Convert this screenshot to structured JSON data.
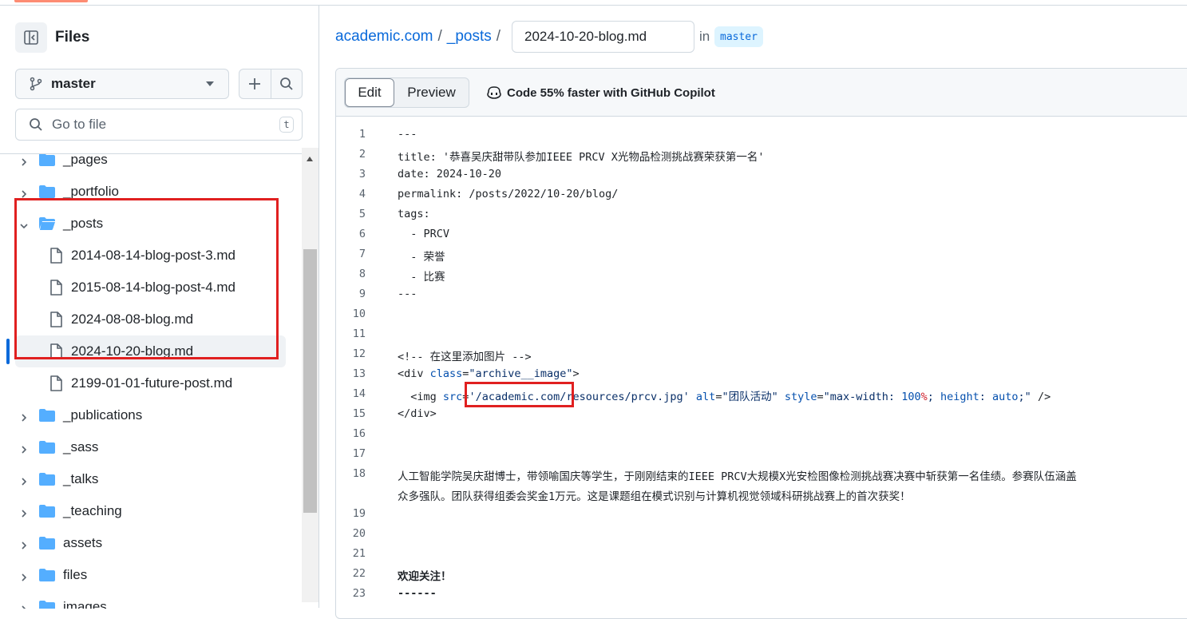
{
  "sidebar": {
    "title": "Files",
    "branch": "master",
    "goto_placeholder": "Go to file",
    "goto_shortcut": "t",
    "tree": [
      {
        "label": "_pages",
        "type": "folder",
        "expanded": false
      },
      {
        "label": "_portfolio",
        "type": "folder",
        "expanded": false
      },
      {
        "label": "_posts",
        "type": "folder",
        "expanded": true
      },
      {
        "label": "2014-08-14-blog-post-3.md",
        "type": "file"
      },
      {
        "label": "2015-08-14-blog-post-4.md",
        "type": "file"
      },
      {
        "label": "2024-08-08-blog.md",
        "type": "file"
      },
      {
        "label": "2024-10-20-blog.md",
        "type": "file",
        "selected": true
      },
      {
        "label": "2199-01-01-future-post.md",
        "type": "file"
      },
      {
        "label": "_publications",
        "type": "folder",
        "expanded": false
      },
      {
        "label": "_sass",
        "type": "folder",
        "expanded": false
      },
      {
        "label": "_talks",
        "type": "folder",
        "expanded": false
      },
      {
        "label": "_teaching",
        "type": "folder",
        "expanded": false
      },
      {
        "label": "assets",
        "type": "folder",
        "expanded": false
      },
      {
        "label": "files",
        "type": "folder",
        "expanded": false
      },
      {
        "label": "images",
        "type": "folder",
        "expanded": false
      }
    ]
  },
  "breadcrumb": {
    "repo": "academic.com",
    "sep": "/",
    "folder": "_posts",
    "filename": "2024-10-20-blog.md",
    "in_label": "in",
    "branch": "master"
  },
  "editor": {
    "tab_edit": "Edit",
    "tab_preview": "Preview",
    "copilot_text": "Code 55% faster with GitHub Copilot",
    "lines": [
      {
        "n": "1",
        "text": "---"
      },
      {
        "n": "2",
        "text": "title: '恭喜吴庆甜带队参加IEEE PRCV X光物品检测挑战赛荣获第一名'"
      },
      {
        "n": "3",
        "text": "date: 2024-10-20"
      },
      {
        "n": "4",
        "text": "permalink: /posts/2022/10-20/blog/"
      },
      {
        "n": "5",
        "text": "tags:"
      },
      {
        "n": "6",
        "text": "  - PRCV"
      },
      {
        "n": "7",
        "text": "  - 荣誉"
      },
      {
        "n": "8",
        "text": "  - 比赛"
      },
      {
        "n": "9",
        "text": "---"
      },
      {
        "n": "10",
        "text": ""
      },
      {
        "n": "11",
        "text": ""
      },
      {
        "n": "12",
        "text": "<!-- 在这里添加图片 -->"
      },
      {
        "n": "13",
        "text": "<div class=\"archive__image\">"
      },
      {
        "n": "14",
        "text": "  <img src='/academic.com/resources/prcv.jpg' alt=\"团队活动\" style=\"max-width: 100%; height: auto;\" />"
      },
      {
        "n": "15",
        "text": "</div>"
      },
      {
        "n": "16",
        "text": ""
      },
      {
        "n": "17",
        "text": ""
      },
      {
        "n": "18",
        "text": "人工智能学院吴庆甜博士，带领喻国庆等学生，于刚刚结束的IEEE PRCV大规模X光安检图像检测挑战赛决赛中斩获第一名佳绩。参赛队伍涵盖"
      },
      {
        "n": "",
        "text": "众多强队。团队获得组委会奖金1万元。这是课题组在模式识别与计算机视觉领域科研挑战赛上的首次获奖！"
      },
      {
        "n": "19",
        "text": ""
      },
      {
        "n": "20",
        "text": ""
      },
      {
        "n": "21",
        "text": ""
      },
      {
        "n": "22",
        "text": "欢迎关注！"
      },
      {
        "n": "23",
        "text": "------"
      }
    ]
  }
}
